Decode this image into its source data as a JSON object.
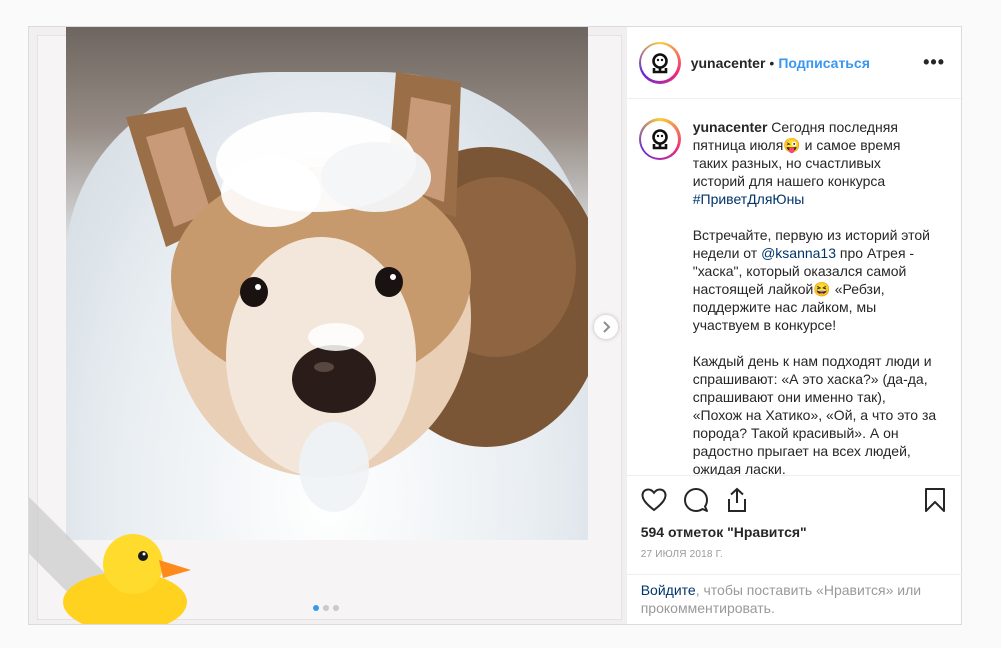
{
  "header": {
    "username": "yunacenter",
    "separator": "•",
    "follow_label": "Подписаться",
    "more_label": "•••"
  },
  "caption": {
    "username": "yunacenter",
    "p1_text": " Сегодня последняя пятница июля😜 и самое время таких разных, но счастливых историй для нашего конкурса ",
    "p1_hashtag": "#ПриветДляЮны",
    "p2_text_a": "Встречайте, первую из историй этой недели от ",
    "p2_mention": "@ksanna13",
    "p2_text_b": " про Атрея - \"хаска\", который оказался самой настоящей лайкой😆 «Ребзи, поддержите нас лайком, мы участвуем в конкурсе!",
    "p3_text": "Каждый день к нам подходят люди и спрашивают: «А это хаска?» (да-да, спрашивают они именно так), «Похож на Хатико», «Ой, а что это за порода? Такой красивый». А он радостно прыгает на всех людей, ожидая ласки."
  },
  "actions": {
    "like_icon": "heart-icon",
    "comment_icon": "comment-icon",
    "share_icon": "share-icon",
    "save_icon": "bookmark-icon"
  },
  "likes_text": "594 отметок \"Нравится\"",
  "date_text": "27 июля 2018 г.",
  "login": {
    "link_label": "Войдите",
    "rest_text": ", чтобы поставить «Нравится» или прокомментировать."
  },
  "carousel": {
    "slide_count": 3,
    "current_slide": 1
  },
  "colors": {
    "link": "#3897f0",
    "hashtag": "#003569",
    "muted": "#999999"
  }
}
